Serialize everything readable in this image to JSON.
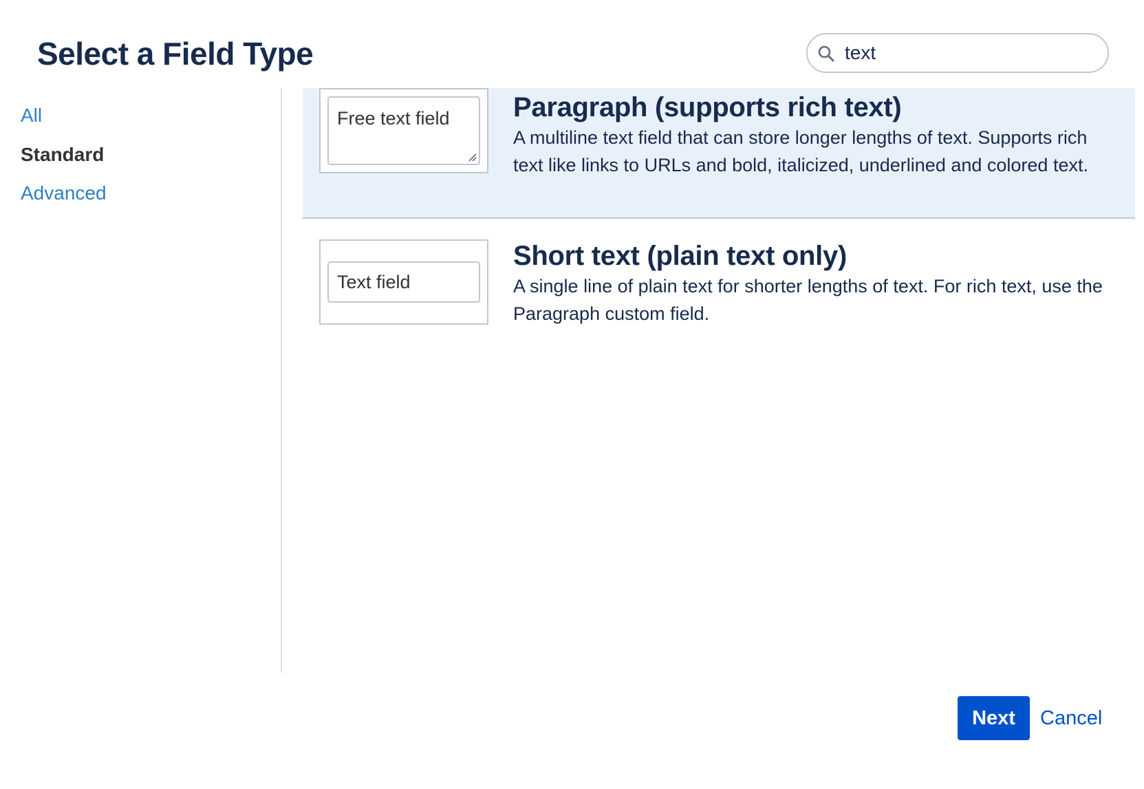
{
  "header": {
    "title": "Select a Field Type",
    "search": {
      "value": "text",
      "icon": "search-icon"
    }
  },
  "sidebar": {
    "items": [
      {
        "label": "All",
        "active": false
      },
      {
        "label": "Standard",
        "active": true
      },
      {
        "label": "Advanced",
        "active": false
      }
    ]
  },
  "options": [
    {
      "preview_text": "Free text field",
      "preview_type": "textarea",
      "title": "Paragraph (supports rich text)",
      "description": "A multiline text field that can store longer lengths of text. Supports rich text like links to URLs and bold, italicized, underlined and colored text.",
      "selected": true
    },
    {
      "preview_text": "Text field",
      "preview_type": "input",
      "title": "Short text (plain text only)",
      "description": "A single line of plain text for shorter lengths of text. For rich text, use the Paragraph custom field.",
      "selected": false
    }
  ],
  "footer": {
    "next_label": "Next",
    "cancel_label": "Cancel"
  },
  "colors": {
    "primary": "#0052cc",
    "link": "#2d7fc1",
    "heading": "#172b4d",
    "selected_bg": "#e8f0fa"
  }
}
